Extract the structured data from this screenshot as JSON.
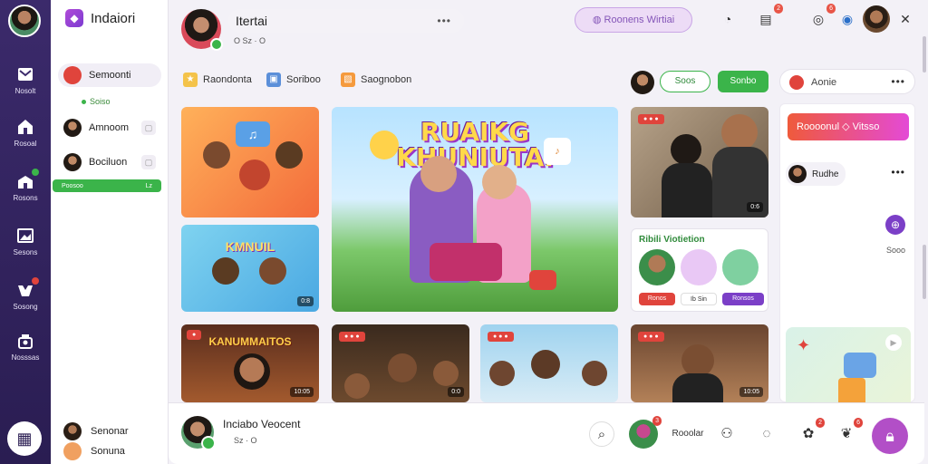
{
  "rail": {
    "items": [
      {
        "label": "Nosolt",
        "icon": "mail-icon"
      },
      {
        "label": "Rosoal",
        "icon": "home-icon"
      },
      {
        "label": "Rosons",
        "icon": "building-icon"
      },
      {
        "label": "Sesons",
        "icon": "image-icon"
      },
      {
        "label": "Sosong",
        "icon": "puzzle-icon"
      },
      {
        "label": "Nosssas",
        "icon": "gift-icon"
      }
    ],
    "apps_icon": "grid-icon"
  },
  "brand": {
    "name": "Indaiori"
  },
  "channels": [
    {
      "name": "Semoonti",
      "sub": "Soiso"
    },
    {
      "name": "Amnoom"
    },
    {
      "name": "Bociluon"
    }
  ],
  "green_bar": {
    "left": "Poosoo",
    "right": "Lz"
  },
  "footer_users": [
    {
      "name": "Senonar"
    },
    {
      "name": "Sonuna"
    }
  ],
  "header": {
    "title": "Itertai",
    "meta": "O Sz · O",
    "more": "•••",
    "live_pill": "Roonens Wirtiai",
    "notify_count_1": "2",
    "notify_count_2": "6"
  },
  "tabs": [
    {
      "label": "Raondonta"
    },
    {
      "label": "Soriboo"
    },
    {
      "label": "Saognobon"
    }
  ],
  "buttons": {
    "ghost": "Soos",
    "green": "Sonbo"
  },
  "right": {
    "head": "Aonie",
    "alert": "Roooonul ◇ Vitsso",
    "user": "Rudhe",
    "count": "Sooo",
    "more": "•••"
  },
  "featured": {
    "title_1": "RUAIKG",
    "title_2": "KHUNIUTAI"
  },
  "tiles": {
    "t2_title": "KMNUIL",
    "t5_title": "KANUMMAITOS",
    "t3_cnt": "0:6",
    "t2_cnt": "0:8",
    "t5_cnt": "10:05",
    "t6_cnt": "0:0",
    "t8_cnt": "10:05"
  },
  "quiz": {
    "title": "Ribili Viotietion",
    "opt1": "Ronos",
    "opt2": "Ib Sin",
    "opt3": "Ronsos"
  },
  "bottom": {
    "name": "Inciabo Veocent",
    "meta": "Sz · O",
    "label": "Rooolar",
    "badge1": "3",
    "badge2": "2",
    "badge3": "6"
  },
  "colors": {
    "rail": "#3b2a6b",
    "accent": "#3bb44a",
    "brand": "#7c3bd1",
    "alert": "#e0443c"
  }
}
